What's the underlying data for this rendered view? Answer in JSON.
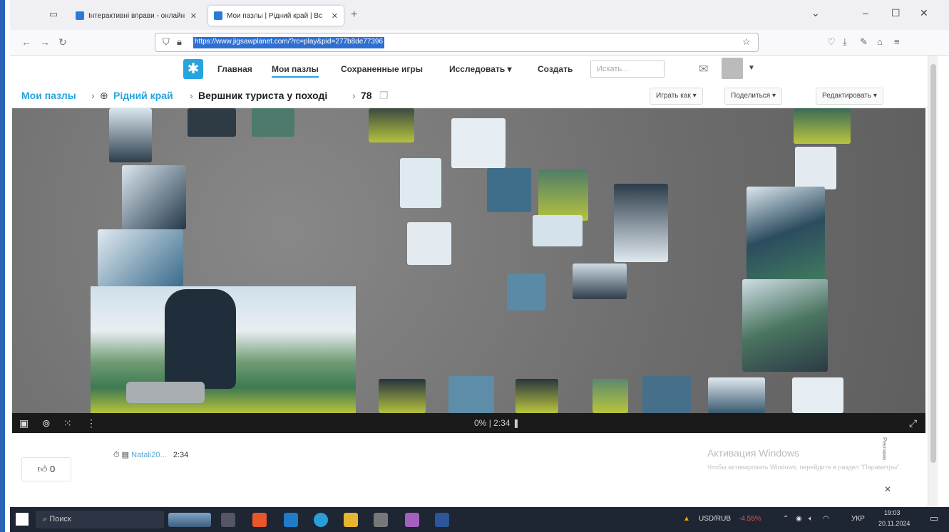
{
  "browser": {
    "tabs": [
      {
        "title": "Інтерактивні вправи - онлайн",
        "active": false
      },
      {
        "title": "Мои пазлы | Рідний край | Вс",
        "active": true
      }
    ],
    "new_tab": "+",
    "url": "https://www.jigsawplanet.com/?rc=play&pid=277b8de77396"
  },
  "site": {
    "nav": {
      "home": "Главная",
      "my_puzzles": "Мои пазлы",
      "saved_games": "Сохраненные игры",
      "explore": "Исследовать ▾",
      "create": "Создать"
    },
    "search_placeholder": "Искать..."
  },
  "breadcrumb": {
    "my_puzzles": "Мои пазлы",
    "folder": "Рідний край",
    "puzzle": "Вершник туриста у поході",
    "pieces": "78"
  },
  "actions": {
    "play_as": "Играть как ▾",
    "share": "Поделиться ▾",
    "edit": "Редактировать ▾"
  },
  "puzzle_toolbar": {
    "progress": "0%",
    "timer": "2:34"
  },
  "record": {
    "user": "Natali20...",
    "time": "2:34"
  },
  "likes": "0",
  "watermark": {
    "title": "Активация Windows",
    "text": "Чтобы активировать Windows, перейдите в раздел \"Параметры\"."
  },
  "ad_label": "Реклама",
  "taskbar": {
    "search": "Поиск",
    "currency": "USD/RUB",
    "currency_change": "-4.55%",
    "lang": "УКР",
    "time": "19:03",
    "date": "20.11.2024"
  }
}
